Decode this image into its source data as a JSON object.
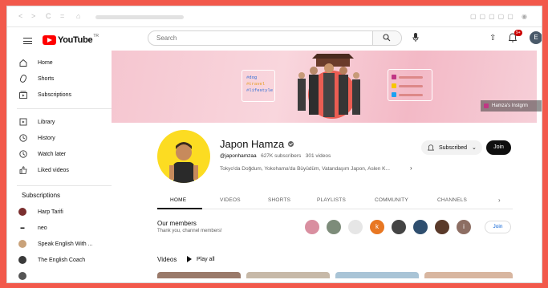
{
  "browser": {
    "buttons": [
      "<",
      ">",
      "C",
      "=",
      "⌂"
    ]
  },
  "topbar": {
    "logo_text": "YouTube",
    "logo_sup": "TR",
    "search_placeholder": "Search"
  },
  "notifications": {
    "count": "9+"
  },
  "user": {
    "initial": "E"
  },
  "sidebar": {
    "items": [
      {
        "label": "Home",
        "icon": "home-icon"
      },
      {
        "label": "Shorts",
        "icon": "shorts-icon"
      },
      {
        "label": "Subscriptions",
        "icon": "subscriptions-icon"
      },
      {
        "label": "Library",
        "icon": "library-icon"
      },
      {
        "label": "History",
        "icon": "history-icon"
      },
      {
        "label": "Watch later",
        "icon": "watch-later-icon"
      },
      {
        "label": "Liked videos",
        "icon": "thumbs-up-icon"
      }
    ],
    "subscriptions_heading": "Subscriptions",
    "subscriptions": [
      {
        "label": "Harp Tarifi",
        "color": "#7a2e2e"
      },
      {
        "label": "neo",
        "color": "#111111"
      },
      {
        "label": "Speak English With ...",
        "color": "#c9a27a"
      },
      {
        "label": "The English Coach",
        "color": "#3a3a3a"
      }
    ]
  },
  "banner": {
    "tags": [
      "#dog",
      "#travel",
      "#lifestyle"
    ],
    "tag_colors": [
      "#2b6bd6",
      "#e59a17",
      "#2b6bd6"
    ],
    "social": [
      {
        "icon": "instagram-icon",
        "color": "#c13584"
      },
      {
        "icon": "snapchat-icon",
        "color": "#f7c600"
      },
      {
        "icon": "twitter-icon",
        "color": "#1da1f2"
      }
    ],
    "link_label": "Hamza's Instgrm"
  },
  "channel": {
    "name": "Japon Hamza",
    "handle": "@japonhamzaa",
    "subscribers": "627K subscribers",
    "videos": "301 videos",
    "description": "Tokyo'da Doğdum, Yokohama'da Büyüdüm, Vatandaşım Japon, Aslen K...",
    "subscribed_label": "Subscribed",
    "join_label": "Join"
  },
  "tabs": [
    {
      "label": "HOME",
      "active": true
    },
    {
      "label": "VIDEOS",
      "active": false
    },
    {
      "label": "SHORTS",
      "active": false
    },
    {
      "label": "PLAYLISTS",
      "active": false
    },
    {
      "label": "COMMUNITY",
      "active": false
    },
    {
      "label": "CHANNELS",
      "active": false
    }
  ],
  "members": {
    "title": "Our members",
    "subtitle": "Thank you, channel members!",
    "avatars": [
      {
        "color": "#d98fa0",
        "initial": ""
      },
      {
        "color": "#7d8c7a",
        "initial": ""
      },
      {
        "color": "#e6e6e6",
        "initial": ""
      },
      {
        "color": "#e87722",
        "initial": "k"
      },
      {
        "color": "#444444",
        "initial": ""
      },
      {
        "color": "#2f4f6f",
        "initial": ""
      },
      {
        "color": "#5a3a2a",
        "initial": ""
      },
      {
        "color": "#8d6e63",
        "initial": "i"
      }
    ],
    "join_label": "Join"
  },
  "videos": {
    "title": "Videos",
    "play_all": "Play all",
    "thumb_colors": [
      "#9a7a6a",
      "#c7b9a8",
      "#a9c4d6",
      "#d8b6a0"
    ]
  }
}
